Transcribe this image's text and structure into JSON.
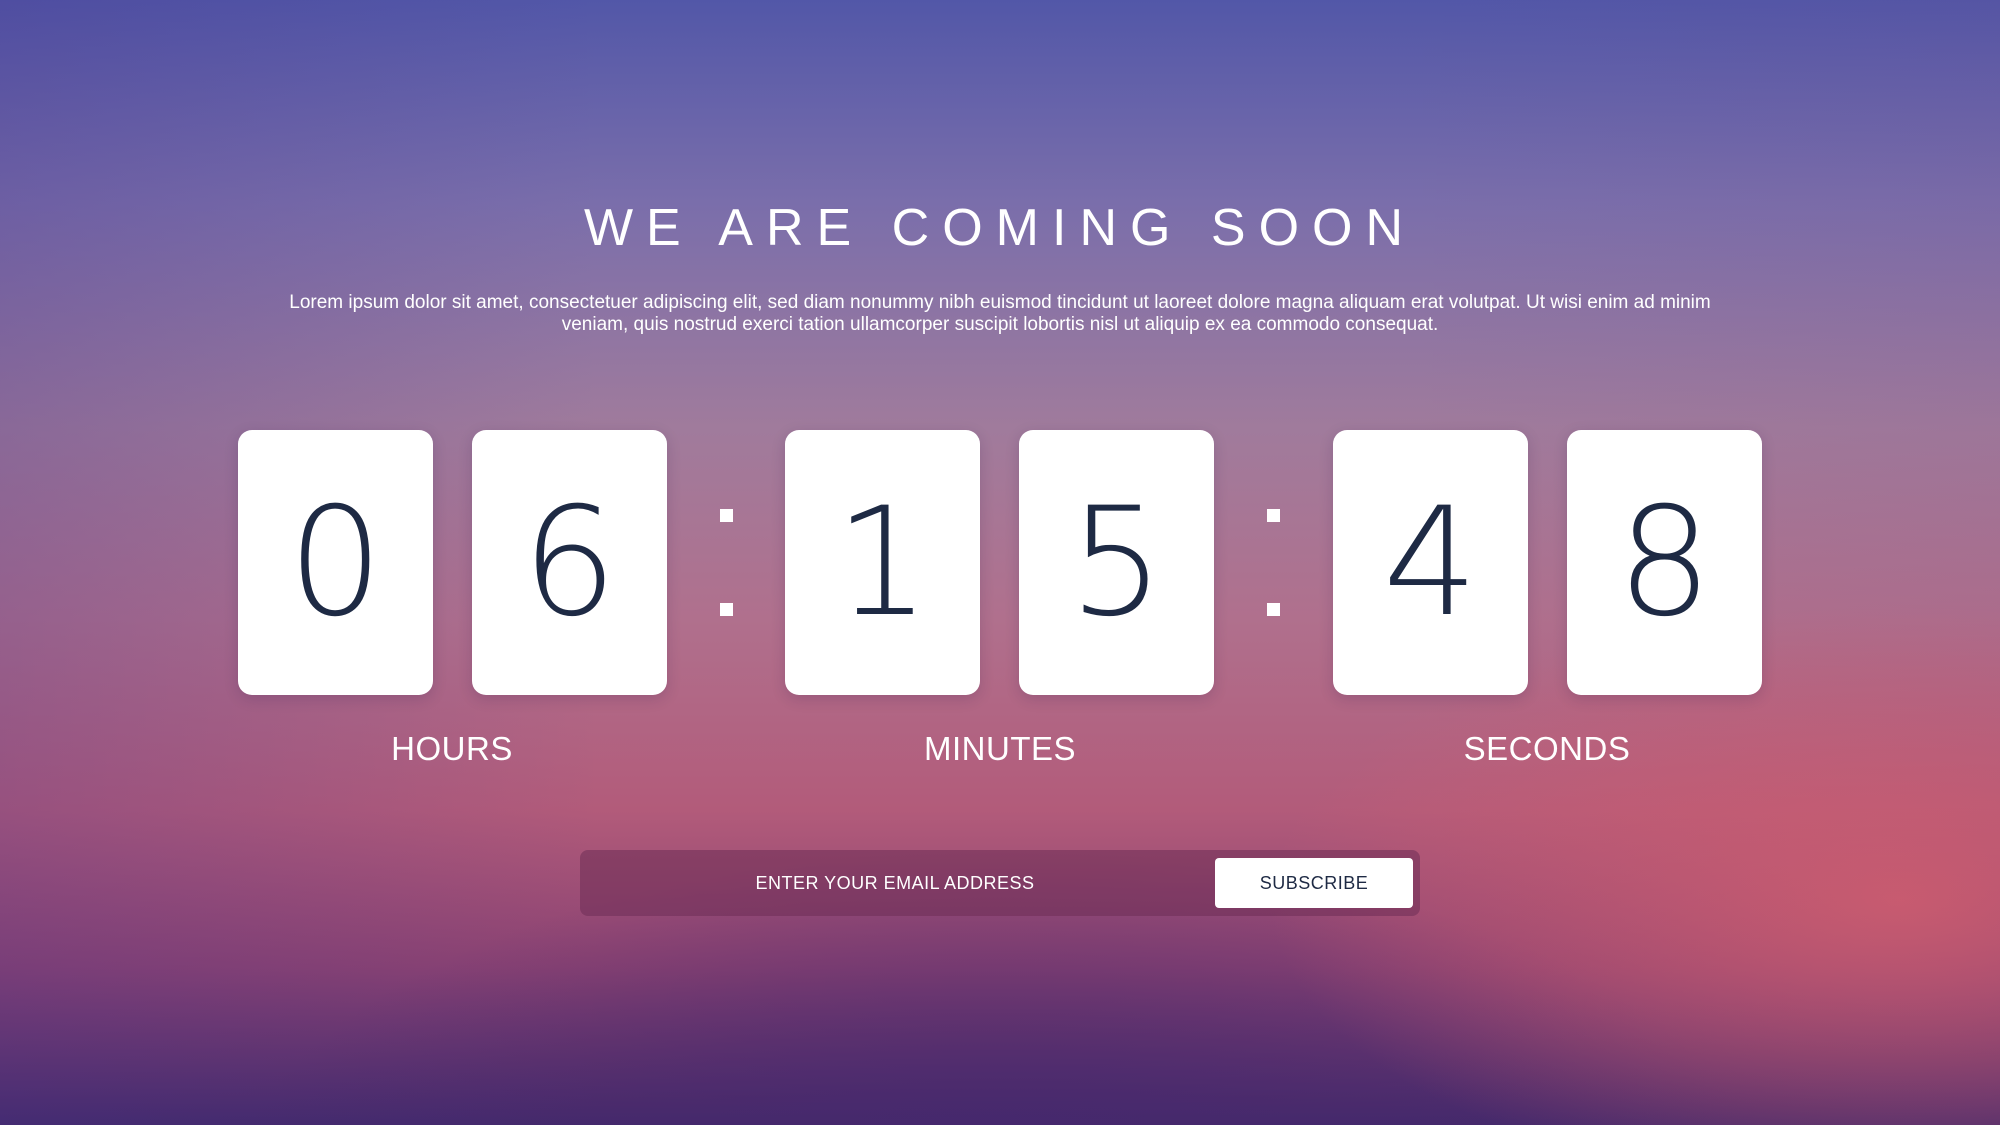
{
  "page": {
    "title": "WE ARE COMING SOON",
    "description": "Lorem ipsum dolor sit amet, consectetuer adipiscing elit, sed diam nonummy nibh euismod tincidunt ut laoreet dolore magna aliquam erat volutpat. Ut wisi enim ad minim veniam, quis nostrud exerci tation ullamcorper suscipit lobortis nisl ut aliquip ex ea commodo consequat."
  },
  "countdown": {
    "hours": {
      "label": "HOURS",
      "digits": [
        "0",
        "6"
      ]
    },
    "minutes": {
      "label": "MINUTES",
      "digits": [
        "1",
        "5"
      ]
    },
    "seconds": {
      "label": "SECONDS",
      "digits": [
        "4",
        "8"
      ]
    }
  },
  "subscribe": {
    "placeholder": "ENTER YOUR EMAIL ADDRESS",
    "button_label": "SUBSCRIBE"
  },
  "colors": {
    "card_background": "#ffffff",
    "digit_text": "#1e2a44",
    "background_top": "#5257a8",
    "background_bottom": "#43296a",
    "accent_pink": "#d6606e"
  }
}
